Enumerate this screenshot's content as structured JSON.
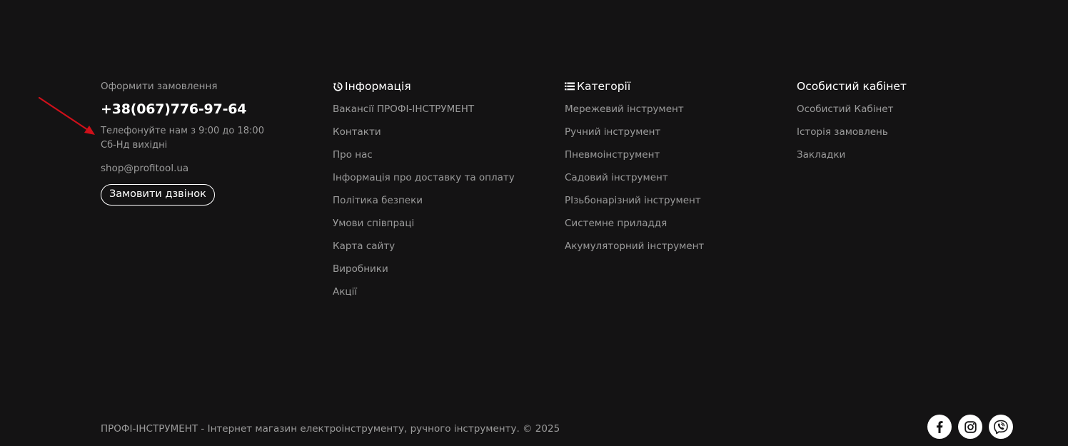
{
  "contact": {
    "order_label": "Оформити замовлення",
    "phone": "+38(067)776-97-64",
    "hours_line1": "Телефонуйте нам з 9:00 до 18:00",
    "hours_line2": "Сб-Нд вихідні",
    "email": "shop@profitool.ua",
    "callback_label": "Замовити дзвінок"
  },
  "info": {
    "title": "Інформація",
    "icon": "history-icon",
    "links": [
      "Вакансії ПРОФІ-ІНСТРУМЕНТ",
      "Контакти",
      "Про нас",
      "Інформація про доставку та оплату",
      "Політика безпеки",
      "Умови співпраці",
      "Карта сайту",
      "Виробники",
      "Акції"
    ]
  },
  "categories": {
    "title": "Категорії",
    "icon": "list-icon",
    "links": [
      "Мережевий інструмент",
      "Ручний інструмент",
      "Пневмоінструмент",
      "Садовий інструмент",
      "PIзьбонарізний інструмент",
      "Системне приладдя",
      "Акумуляторний інструмент"
    ]
  },
  "account": {
    "title": "Особистий кабінет",
    "links": [
      "Особистий Кабінет",
      "Історія замовлень",
      "Закладки"
    ]
  },
  "copyright": "ПРОФІ-ІНСТРУМЕНТ - Інтернет магазин електроінструменту, ручного інструменту. © 2025",
  "socials": [
    "facebook-icon",
    "instagram-icon",
    "viber-icon"
  ],
  "colors": {
    "background": "#141314",
    "text": "#9b9b9b",
    "heading": "#ffffff",
    "arrow": "#d0101a"
  }
}
